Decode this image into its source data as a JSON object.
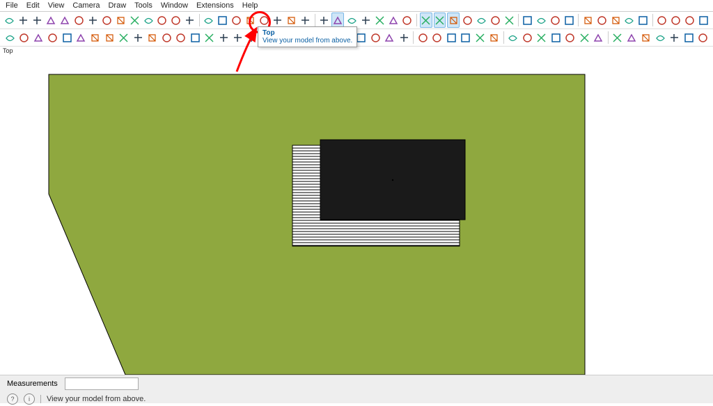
{
  "menu": [
    "File",
    "Edit",
    "View",
    "Camera",
    "Draw",
    "Tools",
    "Window",
    "Extensions",
    "Help"
  ],
  "tooltip": {
    "title": "Top",
    "desc": "View your model from above."
  },
  "view_label": "Top",
  "status": {
    "measurements_label": "Measurements",
    "measurements_value": "",
    "hint": "View your model from above.",
    "help_icon": "?",
    "info_icon": "i"
  },
  "icons": {
    "row1": [
      "select",
      "eraser",
      "line",
      "arc",
      "rect",
      "circle",
      "polygon",
      "pushpull",
      "move",
      "rotate",
      "scale",
      "offset",
      "tape",
      "text",
      "sep",
      "orbit",
      "pan",
      "zoom",
      "zoom-extents",
      "zoom-window",
      "prev",
      "walk",
      "look",
      "sep",
      "iso",
      "top",
      "front",
      "right",
      "back",
      "left",
      "bottom",
      "sep",
      "xray",
      "back-edges",
      "wireframe",
      "hidden-line",
      "shaded",
      "shaded-tex",
      "monochrome",
      "sep",
      "section-plane",
      "section-display",
      "section-cut",
      "section-fill",
      "sep",
      "shadows",
      "fog",
      "solid-union",
      "solid-subtract",
      "solid-intersect",
      "sep",
      "outer-shell",
      "trim",
      "split",
      "sandbox"
    ],
    "row2": [
      "search",
      "pointer",
      "pencil",
      "eraser2",
      "freehand",
      "arc2",
      "rect2",
      "rotated-rect",
      "circle2",
      "polygon2",
      "pushpull2",
      "follow-me",
      "offset2",
      "scale2",
      "axes",
      "dim",
      "protractor",
      "label",
      "sep",
      "3dtext",
      "section",
      "paint",
      "sample",
      "position-texture",
      "sep",
      "always-face",
      "components",
      "layers",
      "entity-info",
      "materials",
      "sep",
      "softener",
      "styles",
      "scenes",
      "outliner",
      "match-photo",
      "instructor",
      "sep",
      "geo-location",
      "add-loc",
      "preview",
      "solid-tools-a",
      "solid-tools-b",
      "solid-tools-c",
      "solid-tools-d",
      "sep",
      "ext-a",
      "ext-b",
      "ext-c",
      "ext-d",
      "ext-e",
      "ext-f",
      "ext-g"
    ]
  },
  "colors": {
    "ground": "#8fa83f",
    "roof": "#1a1a1a",
    "accent": "#0a5fa3",
    "anno": "#ff0000"
  }
}
